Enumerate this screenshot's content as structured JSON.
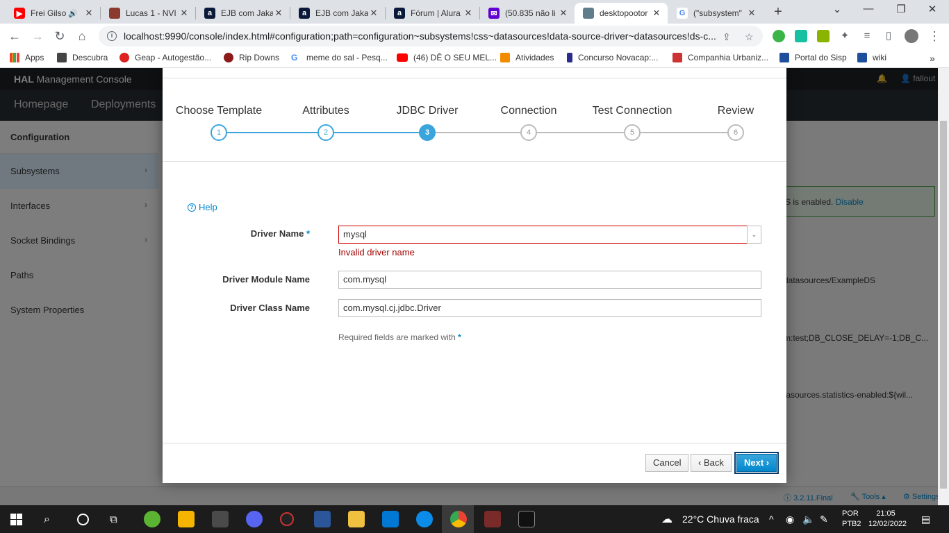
{
  "browser": {
    "tabs": [
      {
        "title": "Frei Gilso",
        "fav_color": "#ff0000"
      },
      {
        "title": "Lucas 1 - NVI",
        "fav_color": "#8b3a2f"
      },
      {
        "title": "EJB com Jaka",
        "fav_color": "#0b1a3a",
        "fav_glyph": "a"
      },
      {
        "title": "EJB com Jaka",
        "fav_color": "#0b1a3a",
        "fav_glyph": "a"
      },
      {
        "title": "Fórum | Alura",
        "fav_color": "#0b1a3a",
        "fav_glyph": "a"
      },
      {
        "title": "(50.835 não li",
        "fav_color": "#6001d2"
      },
      {
        "title": "desktopootor",
        "fav_color": "#607d8b"
      },
      {
        "title": "(\"subsystem\"",
        "fav_color": "#4285f4",
        "fav_glyph": "G"
      }
    ],
    "url": "localhost:9990/console/index.html#configuration;path=configuration~subsystems!css~datasources!data-source-driver~datasources!ds-c...",
    "bookmarks": [
      {
        "label": "Apps"
      },
      {
        "label": "Descubra"
      },
      {
        "label": "Geap - Autogestão..."
      },
      {
        "label": "Rip Downs"
      },
      {
        "label": "meme do sal - Pesq..."
      },
      {
        "label": "(46) DÊ O SEU MEL..."
      },
      {
        "label": "Atividades"
      },
      {
        "label": "Concurso Novacap:..."
      },
      {
        "label": "Companhia Urbaniz..."
      },
      {
        "label": "Portal do Sisp"
      },
      {
        "label": "wiki"
      }
    ]
  },
  "hal": {
    "brand_bold": "HAL",
    "brand_rest": " Management Console",
    "user": "fallout",
    "nav": [
      "Homepage",
      "Deployments"
    ],
    "sidebar_title": "Configuration",
    "sidebar_items": [
      "Subsystems",
      "Interfaces",
      "Socket Bindings",
      "Paths",
      "System Properties"
    ],
    "bg_enabled_text": "S is enabled.",
    "bg_disable_link": "Disable",
    "bg_jndi": "datasources/ExampleDS",
    "bg_conn": "m:test;DB_CLOSE_DELAY=-1;DB_C...",
    "bg_stats": "tasources.statistics-enabled:${wil...",
    "footer_version": "3.2.11.Final",
    "footer_tools": "Tools",
    "footer_settings": "Settings"
  },
  "wizard": {
    "steps": [
      {
        "label": "Choose Template",
        "num": "1",
        "state": "done"
      },
      {
        "label": "Attributes",
        "num": "2",
        "state": "done"
      },
      {
        "label": "JDBC Driver",
        "num": "3",
        "state": "active"
      },
      {
        "label": "Connection",
        "num": "4",
        "state": "pending"
      },
      {
        "label": "Test Connection",
        "num": "5",
        "state": "pending"
      },
      {
        "label": "Review",
        "num": "6",
        "state": "pending"
      }
    ],
    "help": "Help",
    "driver_name_label": "Driver Name",
    "driver_name_value": "mysql",
    "driver_name_error": "Invalid driver name",
    "driver_module_label": "Driver Module Name",
    "driver_module_value": "com.mysql",
    "driver_class_label": "Driver Class Name",
    "driver_class_value": "com.mysql.cj.jdbc.Driver",
    "required_note": "Required fields are marked with",
    "required_mark": "*",
    "cancel": "Cancel",
    "back": "Back",
    "next": "Next"
  },
  "taskbar": {
    "weather": "22°C  Chuva fraca",
    "lang1": "POR",
    "lang2": "PTB2",
    "time": "21:05",
    "date": "12/02/2022"
  }
}
